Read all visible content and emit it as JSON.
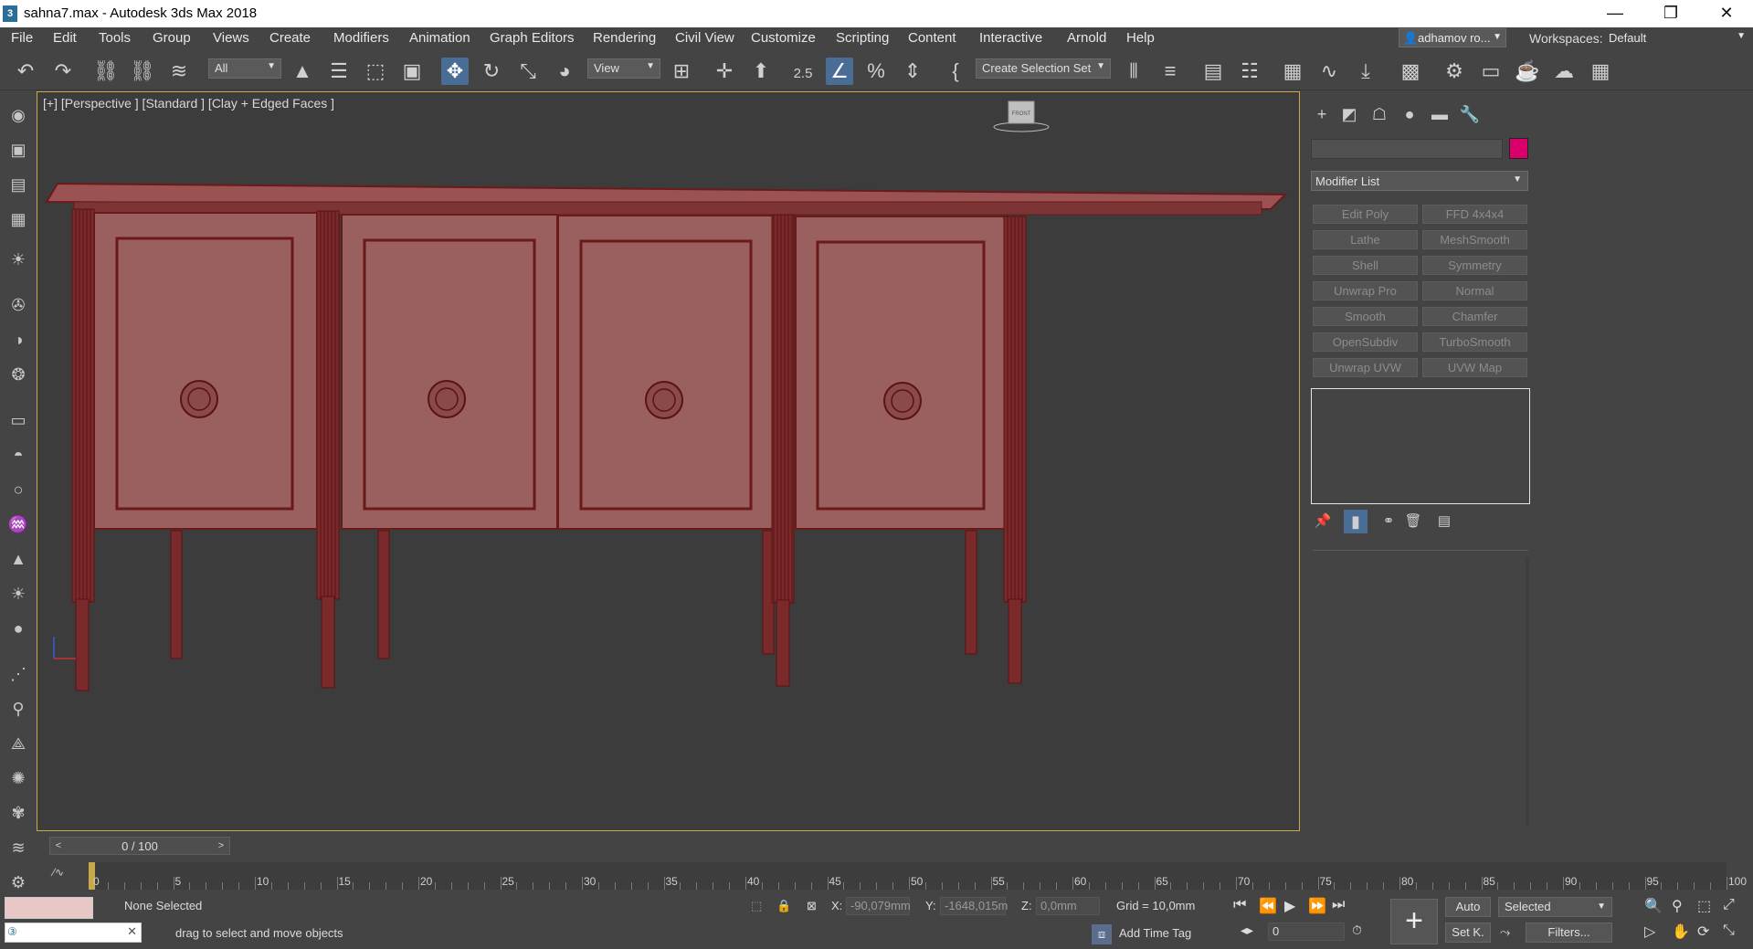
{
  "window": {
    "title": "sahna7.max - Autodesk 3ds Max 2018",
    "app_icon": "3",
    "minimize": "—",
    "maximize": "❐",
    "close": "✕"
  },
  "menu": [
    "File",
    "Edit",
    "Tools",
    "Group",
    "Views",
    "Create",
    "Modifiers",
    "Animation",
    "Graph Editors",
    "Rendering",
    "Civil View",
    "Customize",
    "Scripting",
    "Content",
    "Interactive",
    "Arnold",
    "Help"
  ],
  "user": {
    "name": "adhamov ro...",
    "icon": "user-icon"
  },
  "workspaces": {
    "label": "Workspaces:",
    "value": "Default"
  },
  "toolbar": {
    "filter_dropdown": "All",
    "ref_coord_dropdown": "View",
    "selection_set": "Create Selection Set",
    "snap_label": "2.5"
  },
  "viewport": {
    "label": "[+] [Perspective ] [Standard ] [Clay + Edged Faces ]",
    "viewcube_label": "FRONT",
    "furniture_color": "#9a5f5f",
    "edge_color": "#6b1a1a"
  },
  "command_panel": {
    "modifier_list": "Modifier List",
    "object_color": "#d9006c",
    "modifiers": [
      "Edit Poly",
      "FFD 4x4x4",
      "Lathe",
      "MeshSmooth",
      "Shell",
      "Symmetry",
      "Unwrap Pro",
      "Normal",
      "Smooth",
      "Chamfer",
      "OpenSubdiv",
      "TurboSmooth",
      "Unwrap UVW",
      "UVW Map"
    ]
  },
  "timeline": {
    "frame_display": "0 / 100",
    "prev": "<",
    "next": ">",
    "ticks": [
      "0",
      "5",
      "10",
      "15",
      "20",
      "25",
      "30",
      "35",
      "40",
      "45",
      "50",
      "55",
      "60",
      "65",
      "70",
      "75",
      "80",
      "85",
      "90",
      "95",
      "100"
    ]
  },
  "status": {
    "selection": "None Selected",
    "prompt": "drag to select and move objects",
    "x_label": "X:",
    "x_value": "-90,079mm",
    "y_label": "Y:",
    "y_value": "-1648,015m",
    "z_label": "Z:",
    "z_value": "0,0mm",
    "grid": "Grid = 10,0mm",
    "add_time_tag": "Add Time Tag",
    "auto_key": "Auto",
    "set_key": "Set K.",
    "key_filter": "Selected",
    "filters": "Filters...",
    "current_frame": "0"
  }
}
